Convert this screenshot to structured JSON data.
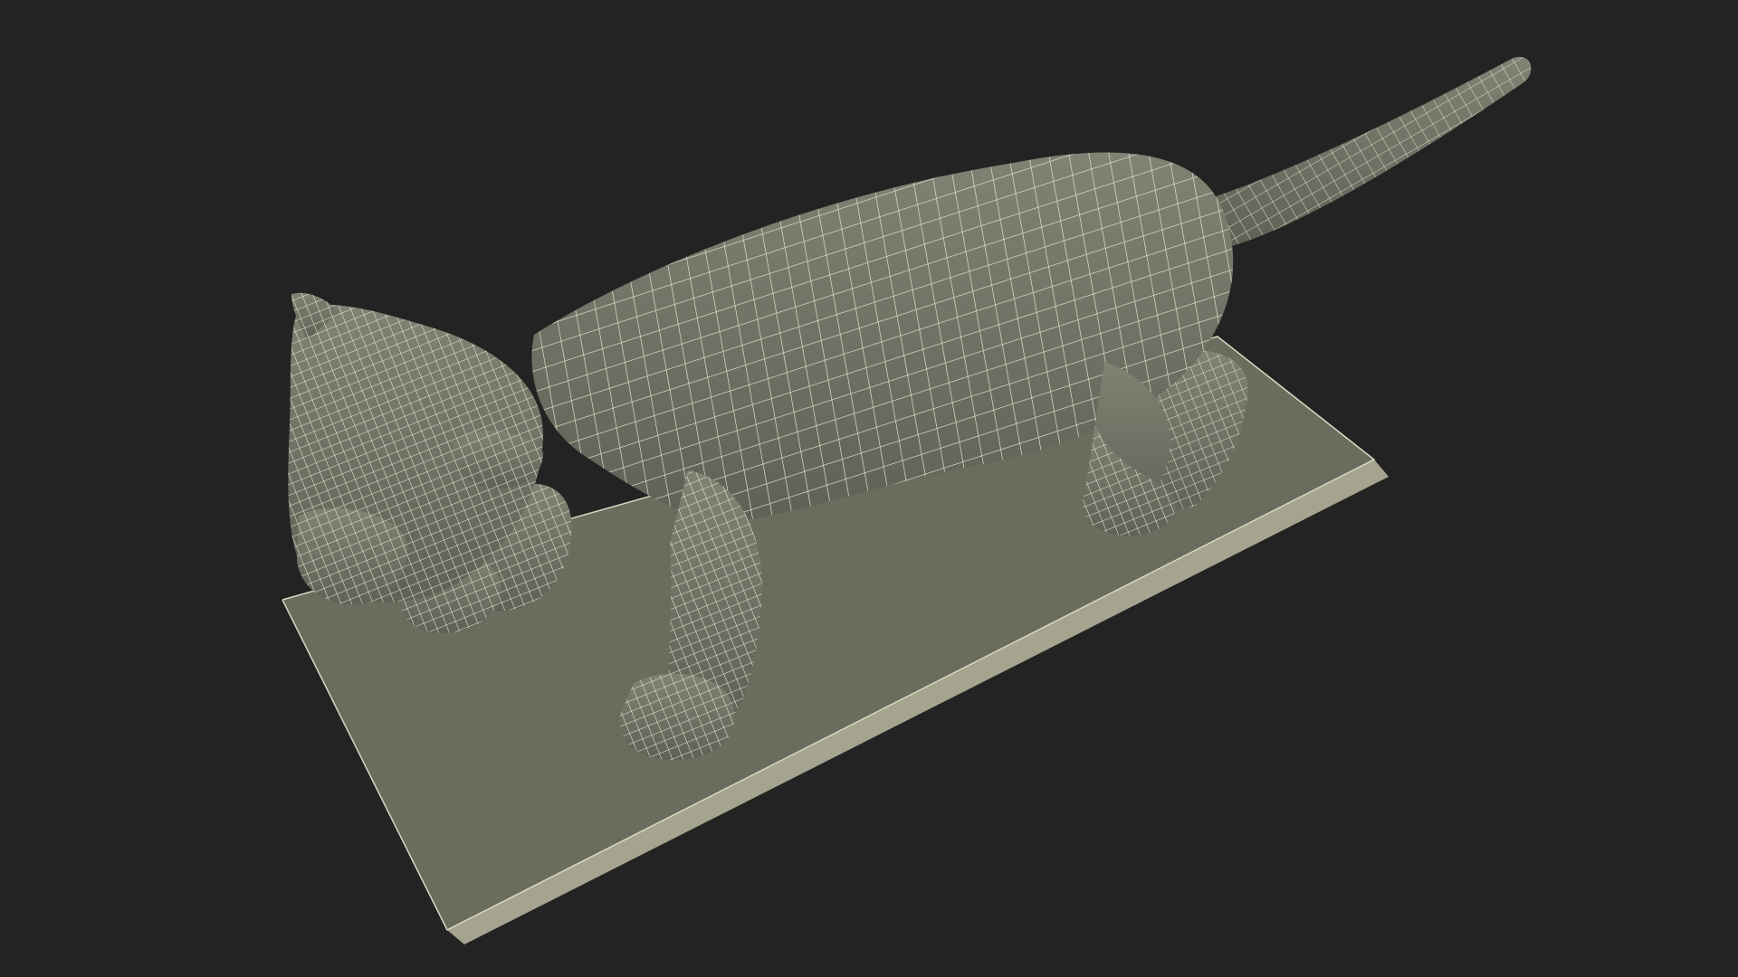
{
  "scene": {
    "subject": "cat-wireframe-model",
    "colors": {
      "background": "#232323",
      "base_top": "#6b6d5e",
      "base_side": "#a7a692",
      "wire": "#e8e6d0",
      "body_fill": "#74766a",
      "body_shade": "#5b5d52"
    }
  }
}
